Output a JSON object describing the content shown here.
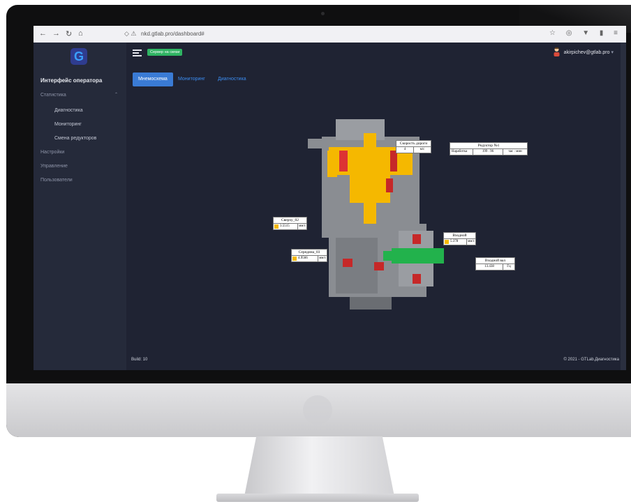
{
  "browser": {
    "url": "nkd.gtlab.pro/dashboard#"
  },
  "sidebar": {
    "logo_letter": "G",
    "title": "Интерфейс оператора",
    "items": [
      {
        "label": "Статистика"
      },
      {
        "label": "Диагностика"
      },
      {
        "label": "Мониторинг"
      },
      {
        "label": "Смена редукторов"
      },
      {
        "label": "Настройки"
      },
      {
        "label": "Управление"
      },
      {
        "label": "Пользователи"
      }
    ]
  },
  "header": {
    "status_badge": "Сервер на связи",
    "user_email": "akirpichev@gtlab.pro"
  },
  "tabs": [
    {
      "label": "Мнемосхема",
      "active": true
    },
    {
      "label": "Мониторинг"
    },
    {
      "label": "Диагностика"
    }
  ],
  "mnemo": {
    "speed": {
      "title": "Скорость дороги",
      "value": "4",
      "unit": "м/с"
    },
    "reducer": {
      "title": "Редуктор №1",
      "label": "Наработка",
      "value": "199 . 96",
      "unit": "час : мин"
    },
    "top_sensor": {
      "title": "Сверху_02",
      "value": "3.5515",
      "unit": "мм/с"
    },
    "mid_sensor": {
      "title": "Середина_03",
      "value": "4.9566",
      "unit": "мм/с"
    },
    "input_sensor": {
      "title": "Входной",
      "value": "5.378",
      "unit": "мм/с"
    },
    "input_shaft": {
      "title": "Входной вал",
      "value": "13.438",
      "unit": "Гц"
    }
  },
  "footer": {
    "build": "Build: 10",
    "copyright": "© 2021 - GTLab.Диагностика"
  },
  "colors": {
    "accent": "#3a7bd5",
    "badge": "#2fb463",
    "part_yellow": "#f5b800",
    "part_green": "#22b24c"
  }
}
